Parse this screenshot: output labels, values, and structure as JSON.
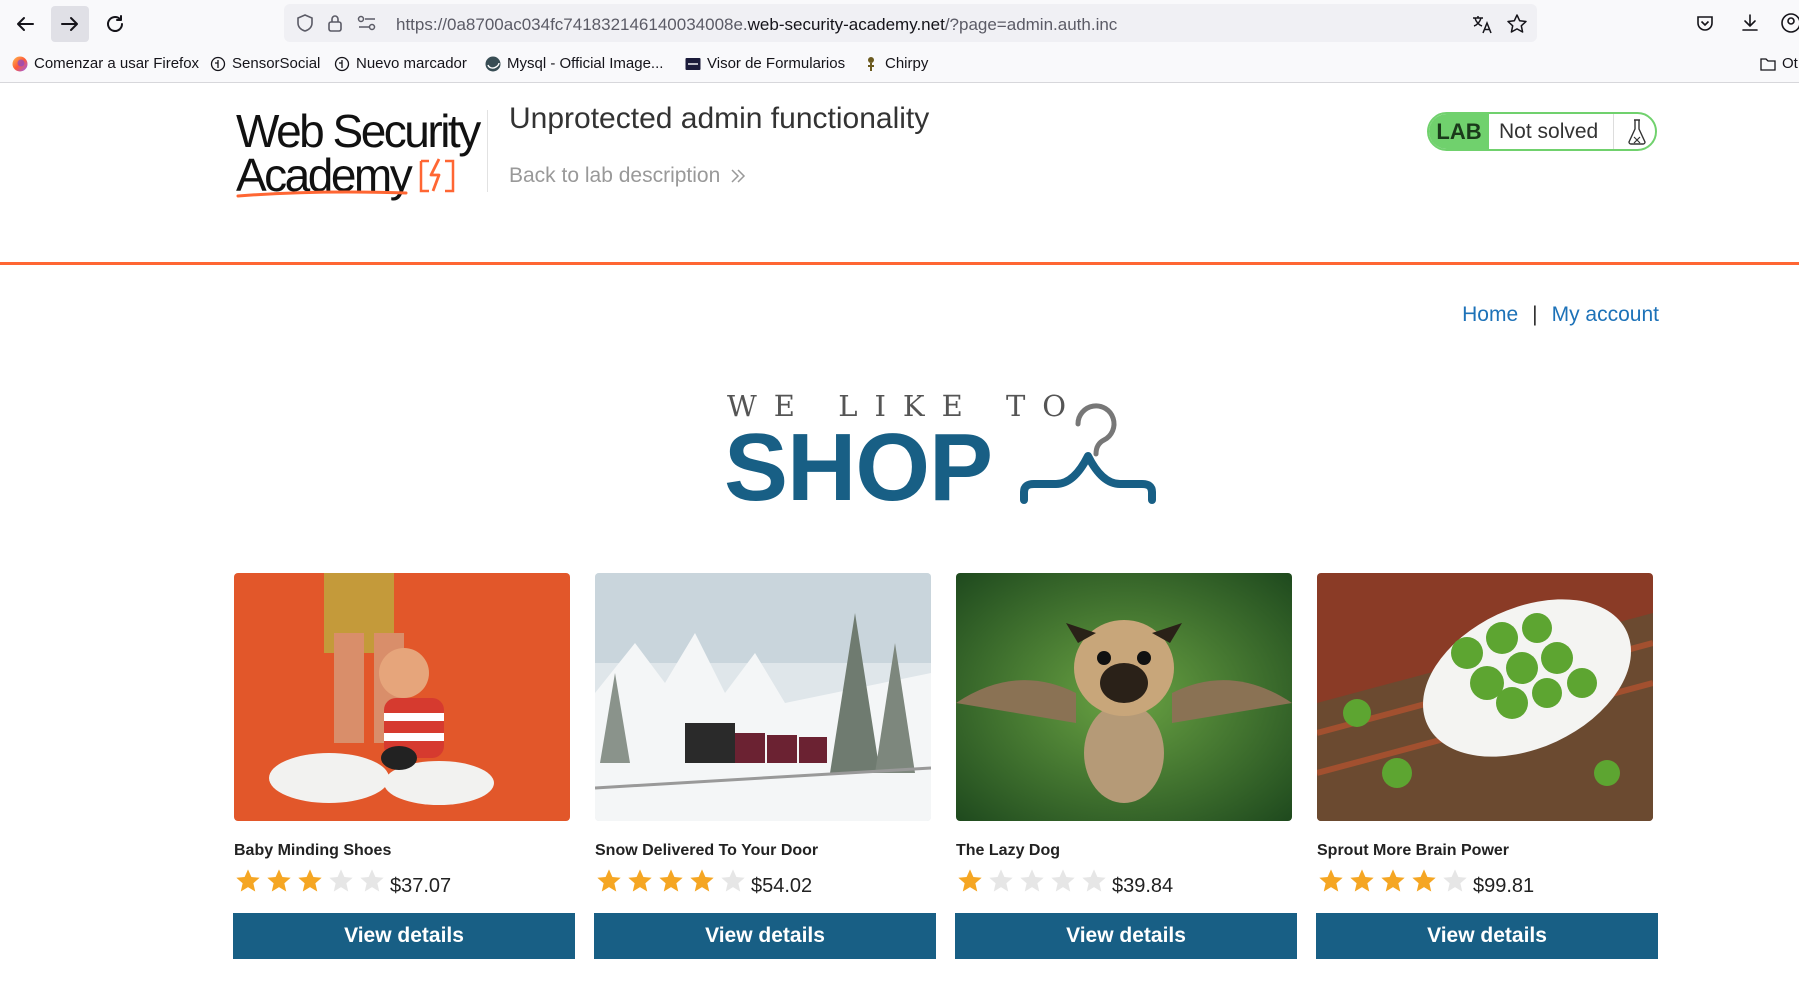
{
  "browser": {
    "url_prefix": "https://0a8700ac034fc741832146140034008e.",
    "url_host": "web-security-academy.net",
    "url_path": "/?page=admin.auth.inc",
    "bookmarks": [
      {
        "label": "Comenzar a usar Firefox",
        "icon": "firefox-icon"
      },
      {
        "label": "SensorSocial",
        "icon": "globe-icon"
      },
      {
        "label": "Nuevo marcador",
        "icon": "globe-icon"
      },
      {
        "label": "Mysql - Official Image...",
        "icon": "docker-icon"
      },
      {
        "label": "Visor de Formularios",
        "icon": "form-icon"
      },
      {
        "label": "Chirpy",
        "icon": "chirpy-icon"
      },
      {
        "label": "Ot",
        "icon": "folder-icon"
      }
    ]
  },
  "header": {
    "logo_line1": "Web Security",
    "logo_line2": "Academy",
    "lab_title": "Unprotected admin functionality",
    "back_link": "Back to lab description",
    "lab_badge": "LAB",
    "lab_status": "Not solved"
  },
  "nav": {
    "home": "Home",
    "separator": "|",
    "account": "My account"
  },
  "hero": {
    "small": "WE LIKE TO",
    "big": "SHOP"
  },
  "colors": {
    "accent_orange": "#ff6633",
    "brand_blue": "#185f85",
    "lab_green": "#70d16d",
    "link_blue": "#1d72b8",
    "star_gold": "#f5a623"
  },
  "products": [
    {
      "name": "Baby Minding Shoes",
      "rating": 3,
      "price": "$37.07",
      "button": "View details"
    },
    {
      "name": "Snow Delivered To Your Door",
      "rating": 4,
      "price": "$54.02",
      "button": "View details"
    },
    {
      "name": "The Lazy Dog",
      "rating": 1,
      "price": "$39.84",
      "button": "View details"
    },
    {
      "name": "Sprout More Brain Power",
      "rating": 4,
      "price": "$99.81",
      "button": "View details"
    }
  ]
}
